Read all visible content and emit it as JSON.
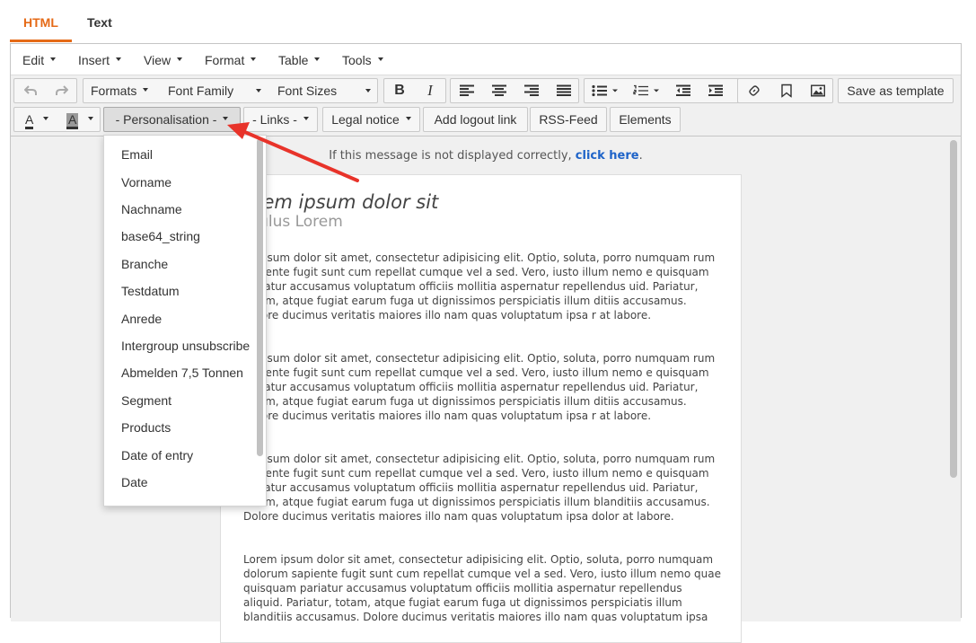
{
  "tabs": {
    "html": "HTML",
    "text": "Text"
  },
  "menubar": [
    "Edit",
    "Insert",
    "View",
    "Format",
    "Table",
    "Tools"
  ],
  "toolbar": {
    "formats": "Formats",
    "font_family": "Font Family",
    "font_sizes": "Font Sizes",
    "bold": "B",
    "italic": "I",
    "save_template": "Save as template",
    "text_color": "A",
    "bg_color": "A",
    "personalisation": "- Personalisation -",
    "links": "- Links -",
    "legal_notice": "Legal notice",
    "add_logout": "Add logout link",
    "rss_feed": "RSS-Feed",
    "elements": "Elements"
  },
  "content": {
    "notice_text": "If this message is not displayed correctly, ",
    "notice_link": "click here",
    "notice_end": ".",
    "title": "orem ipsum dolor sit",
    "subtitle": "otulus Lorem",
    "paragraphs": [
      "m ipsum dolor sit amet, consectetur adipisicing elit. Optio, soluta, porro numquam rum sapiente fugit sunt cum repellat cumque vel a sed. Vero, iusto illum nemo e quisquam pariatur accusamus voluptatum officiis mollitia aspernatur repellendus uid. Pariatur, totam, atque fugiat earum fuga ut dignissimos perspiciatis illum ditiis accusamus. Dolore ducimus veritatis maiores illo nam quas voluptatum ipsa r at labore.",
      "m ipsum dolor sit amet, consectetur adipisicing elit. Optio, soluta, porro numquam rum sapiente fugit sunt cum repellat cumque vel a sed. Vero, iusto illum nemo e quisquam pariatur accusamus voluptatum officiis mollitia aspernatur repellendus uid. Pariatur, totam, atque fugiat earum fuga ut dignissimos perspiciatis illum ditiis accusamus. Dolore ducimus veritatis maiores illo nam quas voluptatum ipsa r at labore.",
      "m ipsum dolor sit amet, consectetur adipisicing elit. Optio, soluta, porro numquam rum sapiente fugit sunt cum repellat cumque vel a sed. Vero, iusto illum nemo e quisquam pariatur accusamus voluptatum officiis mollitia aspernatur repellendus uid. Pariatur, totam, atque fugiat earum fuga ut dignissimos perspiciatis illum blanditiis accusamus. Dolore ducimus veritatis maiores illo nam quas voluptatum ipsa dolor at labore.",
      "Lorem ipsum dolor sit amet, consectetur adipisicing elit. Optio, soluta, porro numquam dolorum sapiente fugit sunt cum repellat cumque vel a sed. Vero, iusto illum nemo quae quisquam pariatur accusamus voluptatum officiis mollitia aspernatur repellendus aliquid. Pariatur, totam, atque fugiat earum fuga ut dignissimos perspiciatis illum blanditiis accusamus. Dolore ducimus veritatis maiores illo nam quas voluptatum ipsa"
    ]
  },
  "dropdown": {
    "items": [
      "Email",
      "Vorname",
      "Nachname",
      "base64_string",
      "Branche",
      "Testdatum",
      "Anrede",
      "Intergroup unsubscribe",
      "Abmelden 7,5 Tonnen",
      "Segment",
      "Products",
      "Date of entry",
      "Date"
    ]
  },
  "colors": {
    "accent": "#e56a17",
    "link": "#1e63c8",
    "annotation_arrow": "#e8332a"
  }
}
